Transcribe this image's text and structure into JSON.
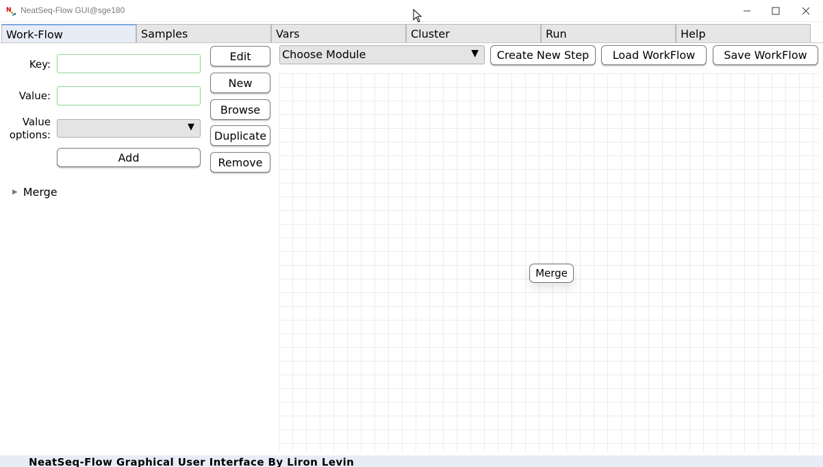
{
  "window": {
    "title": "NeatSeq-Flow GUI@sge180",
    "minimize_icon": "minimize-icon",
    "maximize_icon": "maximize-icon",
    "close_icon": "close-icon"
  },
  "tabs": [
    {
      "label": "Work-Flow",
      "active": true
    },
    {
      "label": "Samples",
      "active": false
    },
    {
      "label": "Vars",
      "active": false
    },
    {
      "label": "Cluster",
      "active": false
    },
    {
      "label": "Run",
      "active": false
    },
    {
      "label": "Help",
      "active": false
    }
  ],
  "editor": {
    "key_label": "Key:",
    "key_value": "",
    "value_label": "Value:",
    "value_value": "",
    "value_options_label_line1": "Value",
    "value_options_label_line2": "options:",
    "value_options_selected": "",
    "add_label": "Add"
  },
  "side_buttons": {
    "edit": "Edit",
    "new": "New",
    "browse": "Browse",
    "duplicate": "Duplicate",
    "remove": "Remove"
  },
  "tree": {
    "items": [
      {
        "label": "Merge",
        "expanded": false
      }
    ]
  },
  "toolbar": {
    "module_select": "Choose Module",
    "create_step": "Create New Step",
    "load_workflow": "Load WorkFlow",
    "save_workflow": "Save WorkFlow"
  },
  "canvas": {
    "nodes": [
      {
        "label": "Merge"
      }
    ]
  },
  "status": {
    "text": "NeatSeq-Flow Graphical User Interface By Liron Levin"
  },
  "colors": {
    "active_tab": "#e8ecf6",
    "input_border": "#8fd18f",
    "status_bar": "#e8ecf6"
  }
}
